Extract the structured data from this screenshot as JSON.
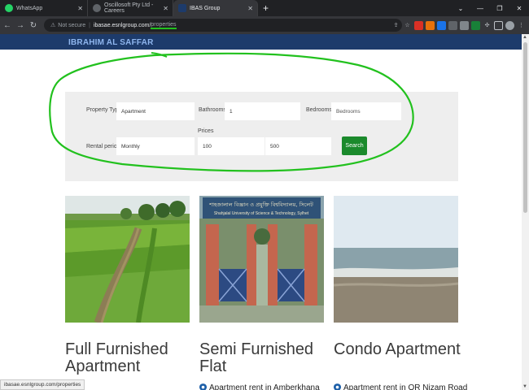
{
  "browser": {
    "tabs": [
      {
        "title": "WhatsApp",
        "icon": "whatsapp-icon",
        "color": "#25d366"
      },
      {
        "title": "Oscillosoft Pty Ltd - Careers",
        "icon": "site-icon",
        "color": "#444"
      },
      {
        "title": "IBAS Group",
        "icon": "site-icon",
        "color": "#1d3b6b"
      }
    ],
    "new_tab": "+",
    "security": "Not secure",
    "url_host": "ibasae.esnlgroup.com/",
    "url_path": "properties",
    "status_url": "ibasae.esnlgroup.com/properties"
  },
  "site": {
    "brand": "IBRAHIM AL SAFFAR",
    "header_color": "#1d3b6b"
  },
  "search": {
    "property_type_label": "Property Type",
    "property_type_value": "Apartment",
    "bathrooms_label": "Bathrooms",
    "bathrooms_value": "1",
    "bedrooms_label": "Bedrooms",
    "bedrooms_placeholder": "Bedrooms",
    "rental_period_label": "Rental period",
    "rental_period_value": "Monthly",
    "prices_label": "Prices",
    "price_min": "100",
    "price_max": "500",
    "search_label": "Search",
    "button_color": "#1b8a2c"
  },
  "cards": [
    {
      "title": "Full Furnished Apartment",
      "subtitle": "",
      "image": "green-paddy-field"
    },
    {
      "title": "Semi Furnished Flat",
      "subtitle": "Apartment rent in Amberkhana",
      "image": "university-gate",
      "gate_text": "শাহজালাল বিজ্ঞান ও প্রযুক্তি বিশ্ববিদ্যালয়, সিলেট",
      "gate_text_en": "Shahjalal University of Science & Technology, Sylhet"
    },
    {
      "title": "Condo Apartment",
      "subtitle": "Apartment rent in OR Nizam Road",
      "image": "beach-sea"
    }
  ],
  "annotation_color": "#22c11e"
}
